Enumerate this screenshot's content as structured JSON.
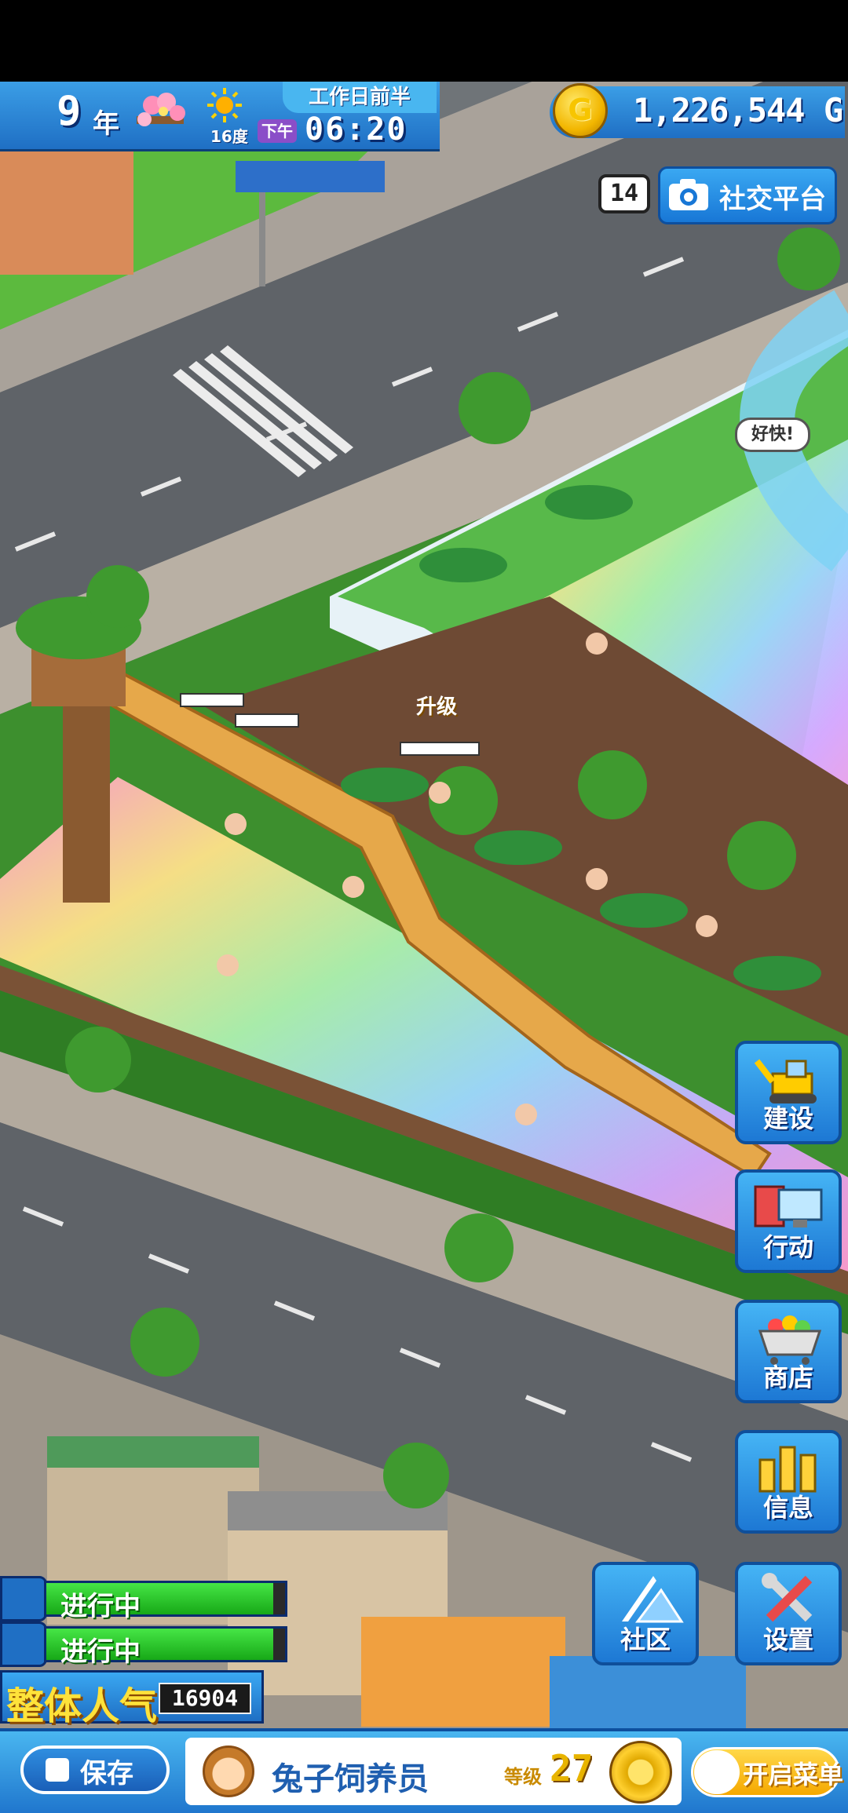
{
  "hud": {
    "year": "9",
    "year_unit": "年",
    "temperature": "16度",
    "day_phase": "工作日前半",
    "am_pm": "下午",
    "time": "06:20",
    "money": "1,226,544 G",
    "coin_symbol": "G"
  },
  "social": {
    "badge_count": "14",
    "label": "社交平台"
  },
  "scene": {
    "speech_bubble": "好快!",
    "level_up_text": "升级",
    "icons": [
      "flower-icon",
      "sun-icon",
      "coin-icon",
      "camera-icon"
    ]
  },
  "side_menu": {
    "build": "建设",
    "action": "行动",
    "shop": "商店",
    "info": "信息",
    "community": "社区",
    "settings": "设置"
  },
  "tasks": [
    {
      "label": "进行中",
      "progress": 0.95
    },
    {
      "label": "进行中",
      "progress": 0.95
    }
  ],
  "popularity": {
    "label": "整体人气",
    "value": "16904"
  },
  "bottom_bar": {
    "save_label": "保存",
    "user_name": "兔子饲养员",
    "level_label": "等级",
    "level_value": "27",
    "menu_toggle_label": "开启菜单"
  },
  "colors": {
    "hud_blue": "#1f6fc4",
    "progress_green": "#17a817",
    "popularity_yellow": "#ffe23a",
    "toggle_gold": "#f5a800"
  }
}
